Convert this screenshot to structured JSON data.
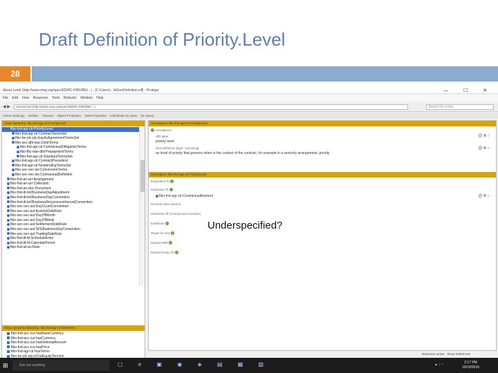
{
  "slide": {
    "title": "Draft Definition of Priority.Level",
    "number": "28",
    "callout": "Underspecified?"
  },
  "window": {
    "title": "About Level (http://www.omg.org/spec/EDMC-FIBO/BE/...) - [C:\\Users\\...\\AGenDefinition.rdf] - Protege",
    "controls": "— ☐ ✕"
  },
  "menu": [
    "File",
    "Edit",
    "View",
    "Reasoner",
    "Tools",
    "Refactor",
    "Window",
    "Help"
  ],
  "address": {
    "value": "AboutLevel (http://www.omg.org/spec/EDMC-FIBO/BE/...)",
    "search_placeholder": "Search for entity"
  },
  "tabs": [
    "Active Ontology",
    "Entities",
    "Classes",
    "Object Properties",
    "Data Properties",
    "Individuals by class",
    "DL Query"
  ],
  "left_pane": {
    "header": "Class hierarchy: fibo-fnd-agr-ctr:PriorityLevel",
    "items": [
      {
        "label": "fibo-fnd-agr-ctr:PriorityLevel",
        "selected": true
      },
      {
        "label": "fibo-fnd-agr-ctr:ContractTermsSet",
        "selected": false
      },
      {
        "label": "fibo-be-plc-pty:EquityAgreementTermsSet",
        "selected": false
      },
      {
        "label": "fibo-sec-dbt-bsic:DebtTerms",
        "selected": false
      },
      {
        "label": "fibo-fnd-agr-ctr:ContractualObligationTerms",
        "selected": false
      },
      {
        "label": "fibo-fbc-dae-dbt:PrepaymentTerms",
        "selected": false
      },
      {
        "label": "fibo-fnd-agr-ctr:StandardTermsSet",
        "selected": false
      },
      {
        "label": "fibo-fnd-agr-ctr:ContractPrecedent",
        "selected": false
      },
      {
        "label": "fibo-fnd-agr-ctr:NonbindingTermsSet",
        "selected": false
      },
      {
        "label": "fibo-sec-sec-iss:ConversionTerms",
        "selected": false
      },
      {
        "label": "fibo-sec-sec-iss:ContractualDefinition",
        "selected": false
      },
      {
        "label": "fibo-fnd-arr-arr:Arrangement",
        "selected": false
      },
      {
        "label": "fibo-fnd-arr-arr:Collection",
        "selected": false
      },
      {
        "label": "fibo-fnd-arr-doc:Document",
        "selected": false
      },
      {
        "label": "fibo-fnd-dt-bd:BusinessDayAdjustment",
        "selected": false
      },
      {
        "label": "fibo-fnd-dt-bd:BusinessDayConvention",
        "selected": false
      },
      {
        "label": "fibo-fnd-dt-bd:BusinessRecurrenceIntervalConvention",
        "selected": false
      },
      {
        "label": "fibo-sec-sec-ast:DayCountConvention",
        "selected": false
      },
      {
        "label": "fibo-sec-sec-ast:AuctionDateRule",
        "selected": false
      },
      {
        "label": "fibo-sec-sec-ast:DayOfMonth",
        "selected": false
      },
      {
        "label": "fibo-sec-sec-ast:DayOfWeek",
        "selected": false
      },
      {
        "label": "fibo-sec-sec-ast:SettlementDateRule",
        "selected": false
      },
      {
        "label": "fibo-sec-sec-ast:SFEBusinessDayConvention",
        "selected": false
      },
      {
        "label": "fibo-sec-sec-ast:TradingDateRule",
        "selected": false
      },
      {
        "label": "fibo-fnd-dt-fd:ScheduleEntry",
        "selected": false
      },
      {
        "label": "fibo-fnd-dt-fd:CalendarPeriod",
        "selected": false
      },
      {
        "label": "fibo-fnd-utl-av:Note",
        "selected": false
      }
    ],
    "sub_header": "Class: property hierarchy: fibo-fnd-agr-ctr:hasTerms",
    "sub_items": [
      {
        "label": "fibo-fnd-acc-cur:hasBaseCurrency",
        "selected": false
      },
      {
        "label": "fibo-fnd-acc-cur:hasCurrency",
        "selected": false
      },
      {
        "label": "fibo-fnd-acc-cur:hasNotionalAmount",
        "selected": false
      },
      {
        "label": "fibo-fnd-acc-cur:hasPrice",
        "selected": false
      },
      {
        "label": "fibo-fnd-agr-ctr:hasTerms",
        "selected": false
      },
      {
        "label": "fibo-be-plc-pty:isOutEquityTermsIn",
        "selected": false
      },
      {
        "label": "fibo-be-plc-pty:isOutEquityTermsOf",
        "selected": false
      },
      {
        "label": "fibo-fnd-dae-dbt:hasAccrualDate",
        "selected": true
      }
    ]
  },
  "right_pane": {
    "annotations_header": "Annotations: fibo-fnd-agr-ctr:PriorityLevel",
    "annotations_label": "Annotations",
    "rdfs_label_key": "rdfs:label",
    "rdfs_label_value": "priority level",
    "skos_definition_key": "skos:definition",
    "skos_definition_lang": "[type: xsd:string]",
    "skos_definition_value": "an level of priority that governs when in the context of the contract, for example in a seniority arrangement, priority",
    "description_header": "Description: fibo-fnd-agr-ctr:PriorityLevel",
    "equivalent_label": "Equivalent To",
    "subclass_label": "SubClass Of",
    "subclass_value": "fibo-fnd-agr-ctr:ContractualElement",
    "general_label": "General class axioms",
    "subclass_anon_label": "SubClass Of (Anonymous Ancestor)",
    "instances_label": "Instances",
    "target_label": "Target for Key",
    "disjoint_label": "Disjoint With",
    "disjoint_union_label": "Disjoint Union Of"
  },
  "status": {
    "reasoner": "Reasoner active",
    "inferences": "Show Inferences"
  },
  "taskbar": {
    "search": "Ask me anything",
    "time": "2:17 PM",
    "date": "10/10/2016"
  }
}
